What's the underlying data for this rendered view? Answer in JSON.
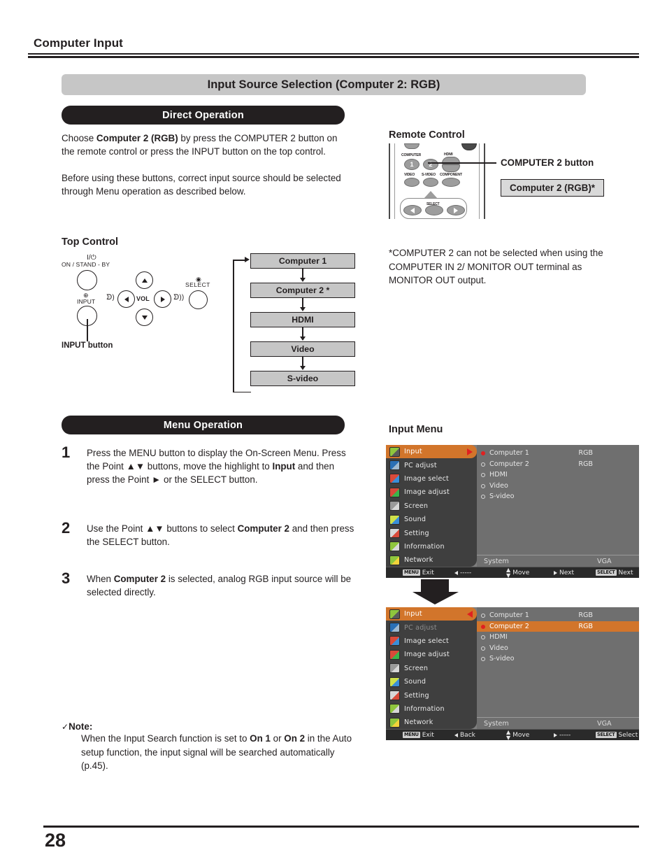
{
  "header": {
    "chapter": "Computer Input"
  },
  "section": {
    "title": "Input Source Selection (Computer 2: RGB)"
  },
  "direct_operation": {
    "pill_label": "Direct Operation",
    "paragraph_1_pre": "Choose ",
    "paragraph_1_bold": "Computer 2 (RGB)",
    "paragraph_1_post": " by press the COMPUTER 2 button on the remote control or press the INPUT button on the top control.",
    "paragraph_2": "Before using these buttons, correct input source should be selected through Menu operation as described below."
  },
  "remote": {
    "label": "Remote Control",
    "callout_button": "COMPUTER 2 button",
    "callout_source": "Computer 2 (RGB)*",
    "buttons": {
      "computer_group": "COMPUTER",
      "computer_1": "1",
      "computer_2": "2",
      "hdmi": "HDMI",
      "video": "VIDEO",
      "s_video": "S-VIDEO",
      "component": "COMPONENT",
      "select": "SELECT"
    }
  },
  "footnote": "*COMPUTER 2 can not be selected when using the COMPUTER IN 2/ MONITOR OUT terminal as MONITOR OUT output.",
  "top_control": {
    "label": "Top Control",
    "power_symbol": "I/⏻",
    "power_label": "ON / STAND - BY",
    "input_symbol": "⊕",
    "input_label": "INPUT",
    "vol_label": "VOL",
    "speaker_left": "ᗦ)",
    "speaker_right": "ᗦ))",
    "select_label": "SELECT",
    "input_button_callout": "INPUT button"
  },
  "flow": {
    "items": [
      "Computer 1",
      "Computer 2 *",
      "HDMI",
      "Video",
      "S-video"
    ]
  },
  "menu_operation": {
    "pill_label": "Menu Operation",
    "steps": [
      {
        "number": "1",
        "parts": [
          {
            "t": "Press the MENU button to display the On-Screen Menu. Press the Point ▲▼ buttons, move the highlight to ",
            "b": false
          },
          {
            "t": "Input",
            "b": true
          },
          {
            "t": " and then press the Point ► or the SELECT button.",
            "b": false
          }
        ]
      },
      {
        "number": "2",
        "parts": [
          {
            "t": "Use the Point ▲▼ buttons to select ",
            "b": false
          },
          {
            "t": "Computer 2",
            "b": true
          },
          {
            "t": " and then press the SELECT button.",
            "b": false
          }
        ]
      },
      {
        "number": "3",
        "parts": [
          {
            "t": "When ",
            "b": false
          },
          {
            "t": "Computer 2",
            "b": true
          },
          {
            "t": " is selected, analog RGB input source will be selected directly.",
            "b": false
          }
        ]
      }
    ]
  },
  "note": {
    "check": "✓",
    "title": "Note:",
    "parts": [
      {
        "t": "When the Input Search function is set to ",
        "b": false
      },
      {
        "t": "On 1",
        "b": true
      },
      {
        "t": " or ",
        "b": false
      },
      {
        "t": "On 2",
        "b": true
      },
      {
        "t": " in the Auto setup function, the input signal will be searched automatically (p.45).",
        "b": false
      }
    ]
  },
  "input_menu": {
    "label": "Input Menu",
    "sidebar": [
      "Input",
      "PC adjust",
      "Image select",
      "Image adjust",
      "Screen",
      "Sound",
      "Setting",
      "Information",
      "Network"
    ],
    "sources": [
      "Computer 1",
      "Computer 2",
      "HDMI",
      "Video",
      "S-video"
    ],
    "system_label": "System",
    "system_value": "VGA",
    "screen_1": {
      "active_sidebar_index": 0,
      "pointer_direction": "right",
      "selected_source_index": 0,
      "highlighted_row_index": -1,
      "values": {
        "Computer 1": "RGB",
        "Computer 2": "RGB"
      },
      "bar": {
        "menu_key": "MENU",
        "exit": "Exit",
        "left": "-----",
        "move": "Move",
        "next": "Next",
        "select_key": "SELECT",
        "select_action": "Next"
      }
    },
    "screen_2": {
      "active_sidebar_index": 0,
      "pointer_direction": "left",
      "selected_source_index": 1,
      "highlighted_row_index": 1,
      "dim_sidebar_index": 1,
      "values": {
        "Computer 1": "RGB",
        "Computer 2": "RGB"
      },
      "bar": {
        "menu_key": "MENU",
        "exit": "Exit",
        "left": "Back",
        "move": "Move",
        "next": "-----",
        "select_key": "SELECT",
        "select_action": "Select"
      }
    }
  },
  "footer": {
    "page_number": "28"
  },
  "colors": {
    "accent_orange": "#d2752b",
    "red_marker": "#e02020",
    "banner_gray": "#c6c6c6",
    "pill_black": "#231f20"
  }
}
